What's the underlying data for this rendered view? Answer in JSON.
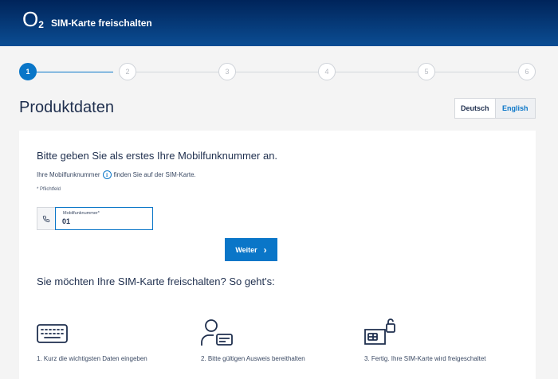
{
  "header": {
    "logo_text": "O",
    "logo_sub": "2",
    "title": "SIM-Karte freischalten"
  },
  "stepper": {
    "steps": [
      "1",
      "2",
      "3",
      "4",
      "5",
      "6"
    ],
    "current": 1
  },
  "page_title": "Produktdaten",
  "language": {
    "selected": "Deutsch",
    "other": "English"
  },
  "form": {
    "prompt": "Bitte geben Sie als erstes Ihre Mobilfunknummer an.",
    "hint_before": "Ihre Mobilfunknummer",
    "hint_icon": "i",
    "hint_after": "finden Sie auf der SIM-Karte.",
    "required_note": "* Pflichtfeld",
    "field_label": "Mobilfunknummer*",
    "field_value": "01",
    "next_label": "Weiter",
    "next_arrow": "›"
  },
  "how": {
    "title": "Sie möchten Ihre SIM-Karte freischalten? So geht's:",
    "steps": [
      {
        "icon": "keyboard-icon",
        "label": "1. Kurz die wichtigsten Daten eingeben"
      },
      {
        "icon": "id-card-person-icon",
        "label": "2. Bitte gültigen Ausweis bereithalten"
      },
      {
        "icon": "sim-unlock-icon",
        "label": "3. Fertig. Ihre SIM-Karte wird freigeschaltet"
      }
    ]
  },
  "colors": {
    "header_dark": "#00245a",
    "header_light": "#0b4d93",
    "accent": "#0a76c8",
    "text": "#1f2f4e"
  }
}
